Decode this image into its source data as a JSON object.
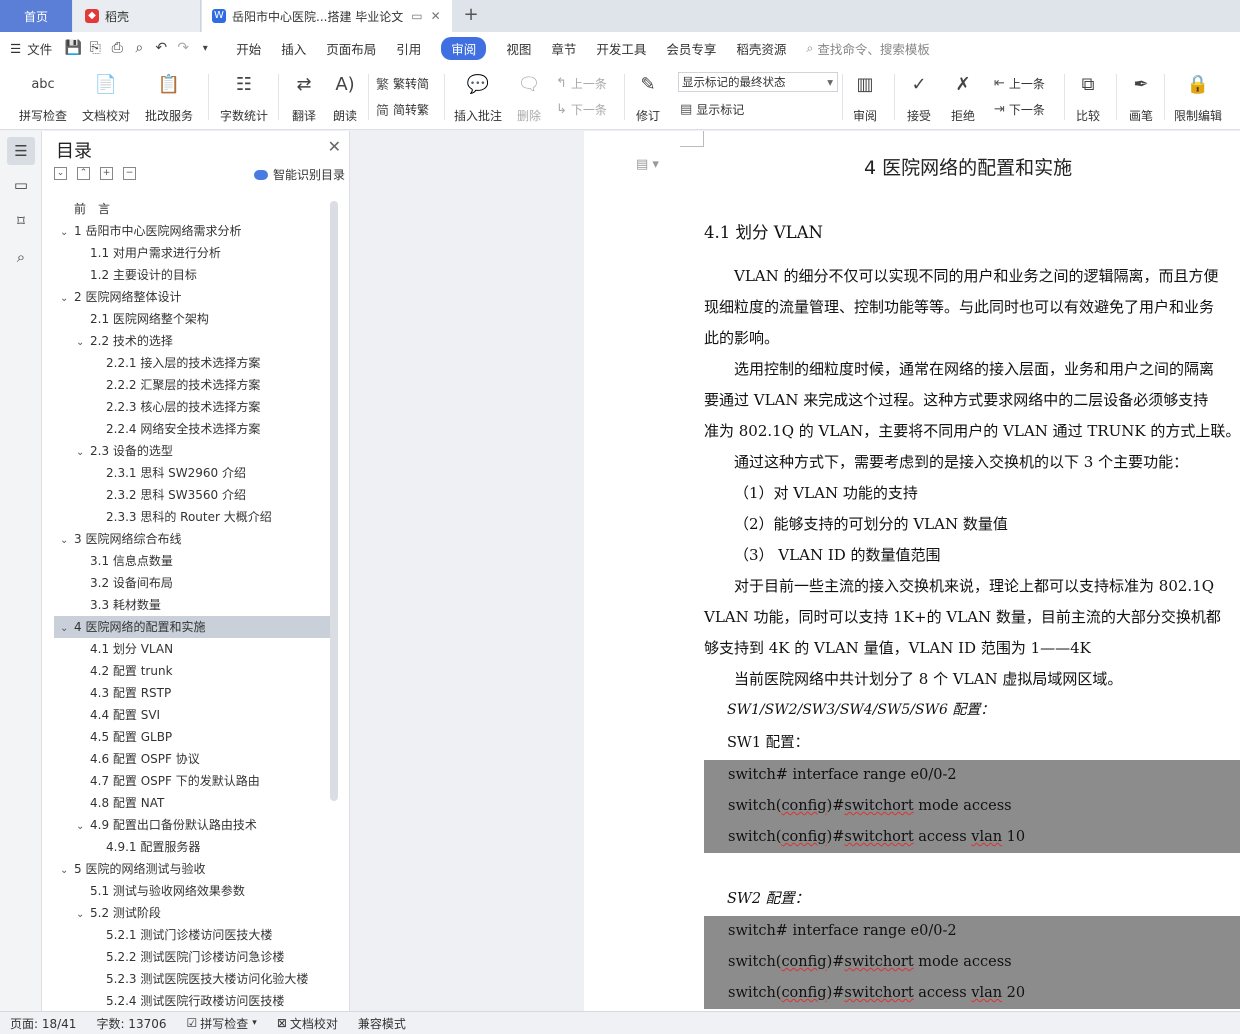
{
  "tabs": {
    "home": "首页",
    "wps": "稻壳",
    "doc": "岳阳市中心医院...搭建 毕业论文"
  },
  "menu": {
    "file": "文件",
    "items": [
      "开始",
      "插入",
      "页面布局",
      "引用",
      "审阅",
      "视图",
      "章节",
      "开发工具",
      "会员专享",
      "稻壳资源"
    ],
    "search": "查找命令、搜索模板"
  },
  "ribbon": {
    "spell": "拼写检查",
    "proof": "文档校对",
    "annot_service": "批改服务",
    "wordcount": "字数统计",
    "translate": "翻译",
    "read": "朗读",
    "trad": "繁转简",
    "simp": "简转繁",
    "insert_comment": "插入批注",
    "delete": "删除",
    "prev": "上一条",
    "next": "下一条",
    "revise": "修订",
    "markup_state": "显示标记的最终状态",
    "show_markup": "显示标记",
    "review": "审阅",
    "accept": "接受",
    "reject": "拒绝",
    "prev2": "上一条",
    "next2": "下一条",
    "compare": "比较",
    "pen": "画笔",
    "restrict": "限制编辑"
  },
  "toc": {
    "title": "目录",
    "smart": "智能识别目录",
    "items": [
      {
        "t": "前　言",
        "lvl": 1,
        "arrow": ""
      },
      {
        "t": "1 岳阳市中心医院网络需求分析",
        "lvl": 1,
        "arrow": "⌄"
      },
      {
        "t": "1.1 对用户需求进行分析",
        "lvl": 2,
        "arrow": ""
      },
      {
        "t": "1.2 主要设计的目标",
        "lvl": 2,
        "arrow": ""
      },
      {
        "t": "2 医院网络整体设计",
        "lvl": 1,
        "arrow": "⌄"
      },
      {
        "t": "2.1 医院网络整个架构",
        "lvl": 2,
        "arrow": ""
      },
      {
        "t": "2.2 技术的选择",
        "lvl": 2,
        "arrow": "⌄"
      },
      {
        "t": "2.2.1  接入层的技术选择方案",
        "lvl": 3,
        "arrow": ""
      },
      {
        "t": "2.2.2  汇聚层的技术选择方案",
        "lvl": 3,
        "arrow": ""
      },
      {
        "t": "2.2.3  核心层的技术选择方案",
        "lvl": 3,
        "arrow": ""
      },
      {
        "t": "2.2.4 网络安全技术选择方案",
        "lvl": 3,
        "arrow": ""
      },
      {
        "t": "2.3 设备的选型",
        "lvl": 2,
        "arrow": "⌄"
      },
      {
        "t": "2.3.1  思科 SW2960 介绍",
        "lvl": 3,
        "arrow": ""
      },
      {
        "t": "2.3.2  思科 SW3560 介绍",
        "lvl": 3,
        "arrow": ""
      },
      {
        "t": "2.3.3  思科的 Router 大概介绍",
        "lvl": 3,
        "arrow": ""
      },
      {
        "t": "3 医院网络综合布线",
        "lvl": 1,
        "arrow": "⌄"
      },
      {
        "t": "3.1  信息点数量",
        "lvl": 2,
        "arrow": ""
      },
      {
        "t": "3.2  设备间布局",
        "lvl": 2,
        "arrow": ""
      },
      {
        "t": "3.3  耗材数量",
        "lvl": 2,
        "arrow": ""
      },
      {
        "t": "4 医院网络的配置和实施",
        "lvl": 1,
        "arrow": "⌄",
        "sel": true
      },
      {
        "t": "4.1  划分 VLAN",
        "lvl": 2,
        "arrow": ""
      },
      {
        "t": "4.2  配置 trunk",
        "lvl": 2,
        "arrow": ""
      },
      {
        "t": "4.3  配置 RSTP",
        "lvl": 2,
        "arrow": ""
      },
      {
        "t": "4.4  配置 SVI",
        "lvl": 2,
        "arrow": ""
      },
      {
        "t": "4.5  配置 GLBP",
        "lvl": 2,
        "arrow": ""
      },
      {
        "t": "4.6  配置 OSPF 协议",
        "lvl": 2,
        "arrow": ""
      },
      {
        "t": "4.7 配置 OSPF 下的发默认路由",
        "lvl": 2,
        "arrow": ""
      },
      {
        "t": "4.8 配置 NAT",
        "lvl": 2,
        "arrow": ""
      },
      {
        "t": "4.9 配置出口备份默认路由技术",
        "lvl": 2,
        "arrow": "⌄"
      },
      {
        "t": "4.9.1 配置服务器",
        "lvl": 3,
        "arrow": ""
      },
      {
        "t": "5 医院的网络测试与验收",
        "lvl": 1,
        "arrow": "⌄"
      },
      {
        "t": "5.1 测试与验收网络效果参数",
        "lvl": 2,
        "arrow": ""
      },
      {
        "t": "5.2 测试阶段",
        "lvl": 2,
        "arrow": "⌄"
      },
      {
        "t": "5.2.1 测试门诊楼访问医技大楼",
        "lvl": 3,
        "arrow": ""
      },
      {
        "t": "5.2.2 测试医院门诊楼访问急诊楼",
        "lvl": 3,
        "arrow": ""
      },
      {
        "t": "5.2.3 测试医院医技大楼访问化验大楼",
        "lvl": 3,
        "arrow": ""
      },
      {
        "t": "5.2.4 测试医院行政楼访问医技楼",
        "lvl": 3,
        "arrow": ""
      }
    ]
  },
  "doc": {
    "h1": "4 医院网络的配置和实施",
    "h2": "4.1  划分 VLAN",
    "p1": "VLAN 的细分不仅可以实现不同的用户和业务之间的逻辑隔离，而且方便",
    "p2": "现细粒度的流量管理、控制功能等等。与此同时也可以有效避免了用户和业务",
    "p3": "此的影响。",
    "p4": "选用控制的细粒度时候，通常在网络的接入层面，业务和用户之间的隔离",
    "p5": "要通过 VLAN 来完成这个过程。这种方式要求网络中的二层设备必须够支持",
    "p6": "准为 802.1Q  的 VLAN，主要将不同用户的 VLAN 通过 TRUNK 的方式上联。",
    "p7": "通过这种方式下，需要考虑到的是接入交换机的以下 3 个主要功能：",
    "l1": "（1）对  VLAN 功能的支持",
    "l2": "（2）能够支持的可划分的 VLAN 数量值",
    "l3": "（3）  VLAN ID 的数量值范围",
    "p8": "对于目前一些主流的接入交换机来说，理论上都可以支持标准为 802.1Q",
    "p9": "VLAN 功能，同时可以支持 1K+的 VLAN 数量，目前主流的大部分交换机都",
    "p10": "够支持到 4K 的 VLAN 量值，VLAN ID 范围为 1——4K",
    "p11": "当前医院网络中共计划分了 8 个 VLAN 虚拟局域网区域。",
    "cfg_all": "SW1/SW2/SW3/SW4/SW5/SW6 配置：",
    "cfg_sw1": "SW1 配置：",
    "cfg_sw2": "SW2 配置：",
    "code1": [
      "switch# interface range e0/0-2",
      "switch(config)#switchort mode access",
      "switch(config)#switchort access vlan 10"
    ],
    "code2": [
      "switch# interface range e0/0-2",
      "switch(config)#switchort mode access",
      "switch(config)#switchort access vlan 20"
    ]
  },
  "status": {
    "page": "页面: 18/41",
    "words": "字数: 13706",
    "spell": "拼写检查",
    "proof": "文档校对",
    "compat": "兼容模式"
  }
}
